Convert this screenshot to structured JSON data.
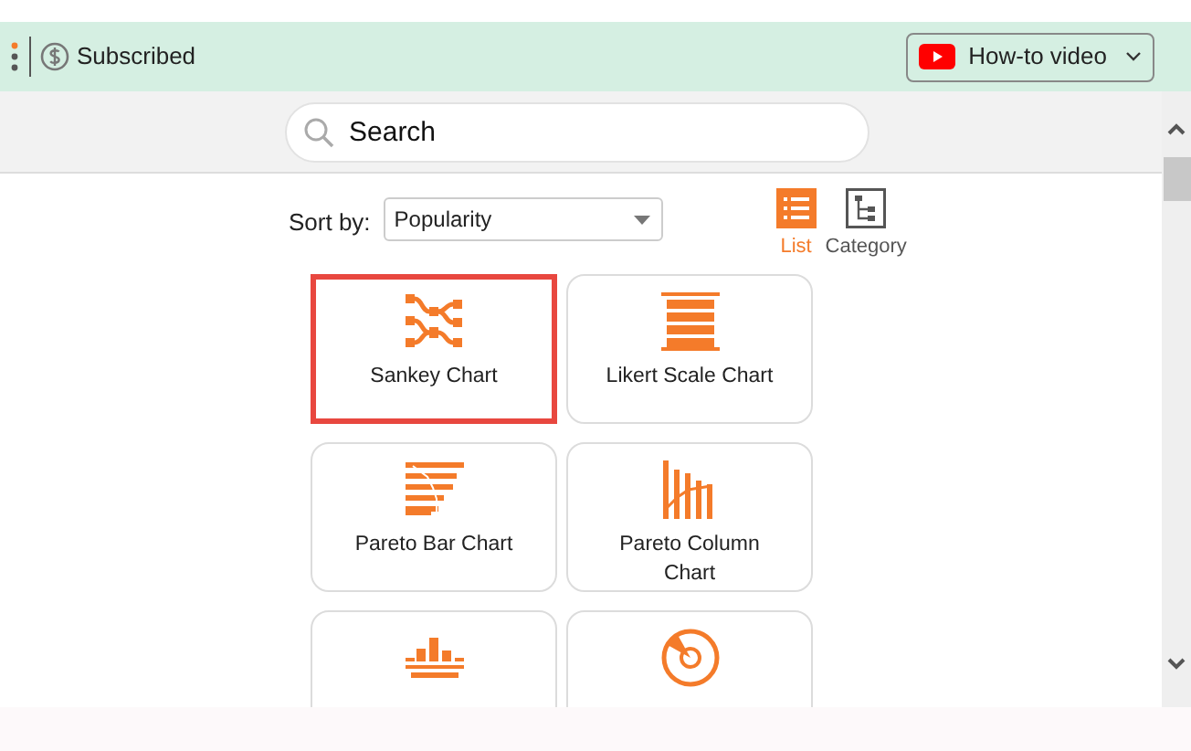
{
  "toolbar": {
    "status": "Subscribed",
    "video_button": "How-to video"
  },
  "search": {
    "placeholder": "Search"
  },
  "sort": {
    "label": "Sort by:",
    "value": "Popularity"
  },
  "views": [
    {
      "label": "List",
      "kind": "list",
      "selected": true
    },
    {
      "label": "Category",
      "kind": "category",
      "selected": false
    }
  ],
  "charts": [
    {
      "label": "Sankey Chart",
      "kind": "sankey",
      "selected": true
    },
    {
      "label": "Likert Scale Chart",
      "kind": "likert",
      "selected": false
    },
    {
      "label": "Pareto Bar Chart",
      "kind": "pareto-bar",
      "selected": false
    },
    {
      "label": "Pareto Column Chart",
      "kind": "pareto-column",
      "selected": false
    },
    {
      "kind": "csat",
      "selected": false
    },
    {
      "kind": "radar",
      "selected": false
    }
  ]
}
